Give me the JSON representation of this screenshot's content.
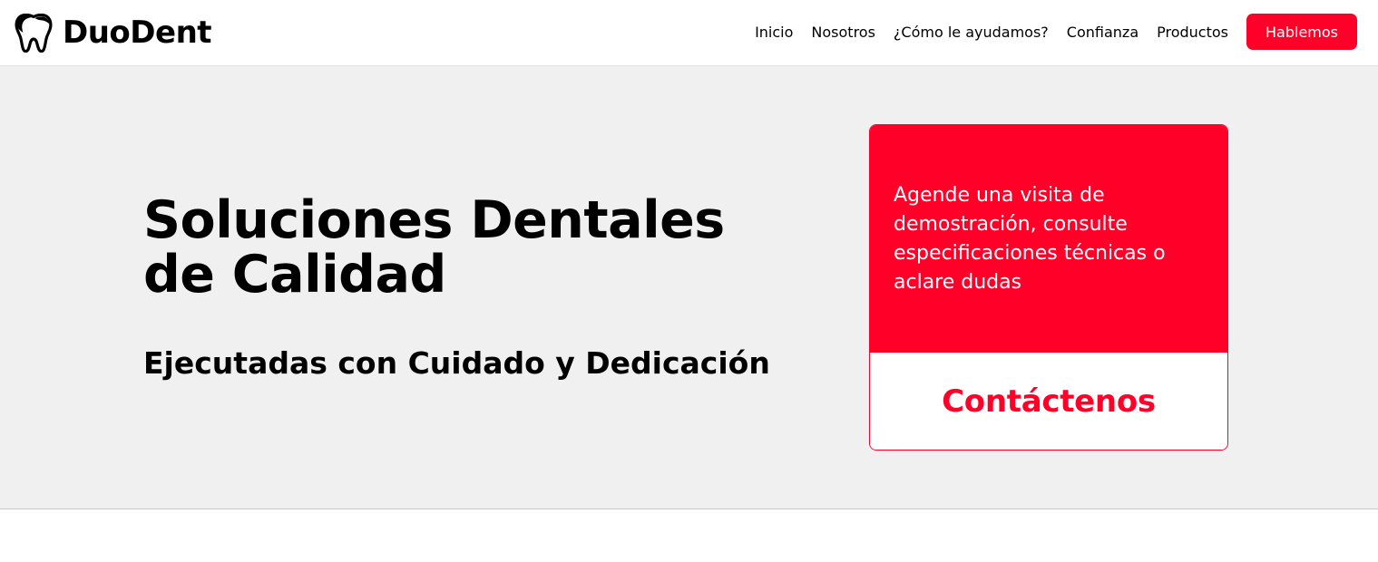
{
  "header": {
    "brand_name": "DuoDent",
    "nav": [
      {
        "label": "Inicio"
      },
      {
        "label": "Nosotros"
      },
      {
        "label": "¿Cómo le ayudamos?"
      },
      {
        "label": "Confianza"
      },
      {
        "label": "Productos"
      }
    ],
    "cta_label": "Hablemos"
  },
  "hero": {
    "title": "Soluciones Dentales de Calidad",
    "subtitle": "Ejecutadas con Cuidado y Dedicación"
  },
  "contact_card": {
    "text": "Agende una visita de demostración, consulte especificaciones técnicas o aclare dudas",
    "link_label": "Contáctenos"
  },
  "icons": {
    "brand": "tooth-icon"
  },
  "colors": {
    "accent": "#ff0029",
    "hero_background": "#f0f0f0",
    "text": "#000000",
    "background": "#ffffff"
  }
}
